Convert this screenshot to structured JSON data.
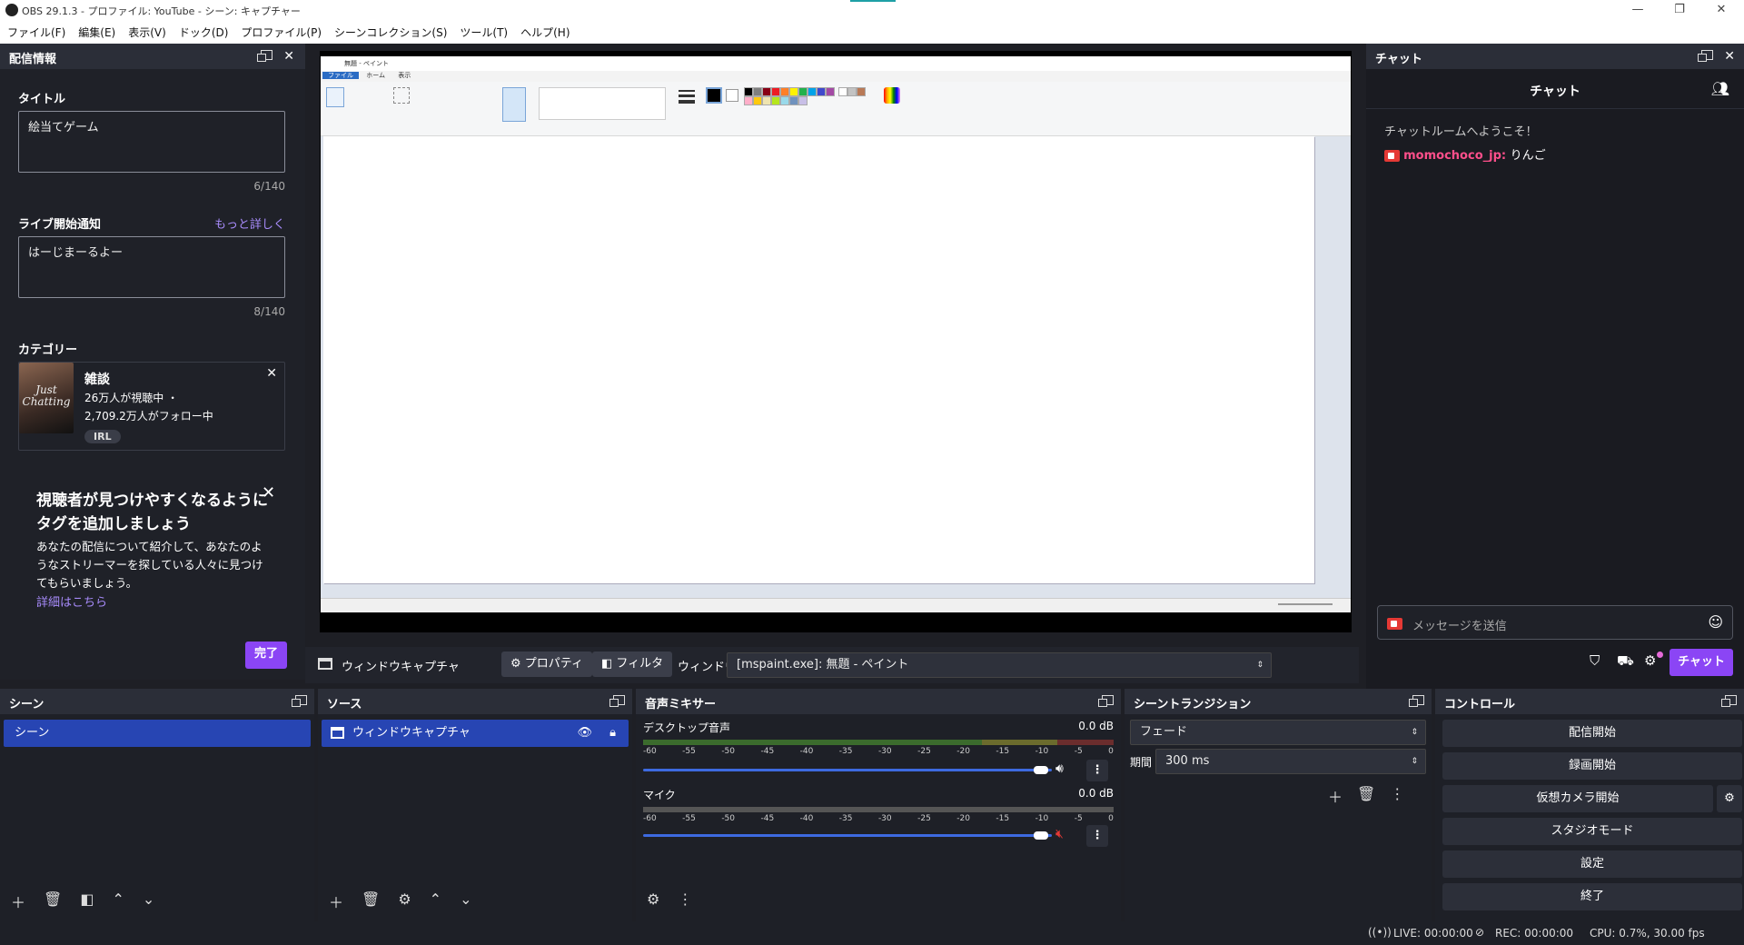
{
  "window": {
    "title": "OBS 29.1.3 - プロファイル: YouTube - シーン: キャプチャー"
  },
  "menu": [
    "ファイル(F)",
    "編集(E)",
    "表示(V)",
    "ドック(D)",
    "プロファイル(P)",
    "シーンコレクション(S)",
    "ツール(T)",
    "ヘルプ(H)"
  ],
  "stream_info": {
    "dock_title": "配信情報",
    "title_label": "タイトル",
    "title_value": "絵当てゲーム",
    "title_count": "6/140",
    "notice_label": "ライブ開始通知",
    "more_link": "もっと詳しく",
    "notice_value": "はーじまーるよー",
    "notice_count": "8/140",
    "category_label": "カテゴリー",
    "category": {
      "name": "雑談",
      "viewers": "26万人が視聴中 ・",
      "followers": "2,709.2万人がフォロー中",
      "tag": "IRL",
      "img_text": "Just Chatting"
    },
    "promo_title": "視聴者が見つけやすくなるようにタグを追加しましょう",
    "promo_body": "あなたの配信について紹介して、あなたのようなストリーマーを探している人々に見つけてもらいましょう。",
    "promo_link": "詳細はこちら",
    "done": "完了"
  },
  "paint": {
    "title": "無題 - ペイント",
    "tabs": [
      "ファイル",
      "ホーム",
      "表示"
    ]
  },
  "source_toolbar": {
    "source_name": "ウィンドウキャプチャ",
    "properties": "プロパティ",
    "filters": "フィルタ",
    "window_label": "ウィンドウ",
    "window_value": "[mspaint.exe]: 無題 - ペイント"
  },
  "chat": {
    "dock_title": "チャット",
    "header": "チャット",
    "welcome": "チャットルームへようこそ！",
    "messages": [
      {
        "user": "momochoco_jp",
        "text": "りんご"
      }
    ],
    "input_placeholder": "メッセージを送信",
    "send_btn": "チャット"
  },
  "scenes": {
    "title": "シーン",
    "items": [
      "シーン"
    ]
  },
  "sources": {
    "title": "ソース",
    "items": [
      "ウィンドウキャプチャ"
    ]
  },
  "mixer": {
    "title": "音声ミキサー",
    "channels": [
      {
        "name": "デスクトップ音声",
        "db": "0.0 dB",
        "muted": false
      },
      {
        "name": "マイク",
        "db": "0.0 dB",
        "muted": true
      }
    ],
    "scale": [
      "-60",
      "-55",
      "-50",
      "-45",
      "-40",
      "-35",
      "-30",
      "-25",
      "-20",
      "-15",
      "-10",
      "-5",
      "0"
    ]
  },
  "transitions": {
    "title": "シーントランジション",
    "type": "フェード",
    "duration_label": "期間",
    "duration": "300 ms"
  },
  "controls": {
    "title": "コントロール",
    "buttons": [
      "配信開始",
      "録画開始",
      "仮想カメラ開始",
      "スタジオモード",
      "設定",
      "終了"
    ]
  },
  "status": {
    "live": "LIVE: 00:00:00",
    "rec": "REC: 00:00:00",
    "cpu": "CPU: 0.7%, 30.00 fps"
  },
  "colors": {
    "accent_purple": "#8b45f5",
    "selection_blue": "#2745b3",
    "chat_user": "#ff4f8b"
  }
}
